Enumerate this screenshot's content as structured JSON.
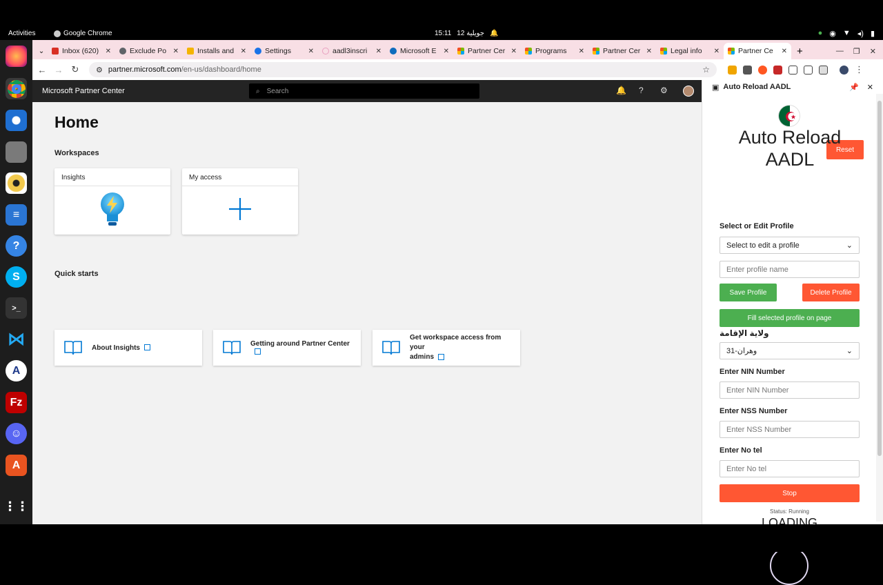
{
  "topbar": {
    "activities": "Activities",
    "app": "Google Chrome",
    "time": "15:11",
    "date": "12 جويلية"
  },
  "dock": {
    "items": [
      "firefox-icon",
      "chrome-icon",
      "thunderbird-icon",
      "files-icon",
      "rhythmbox-icon",
      "writer-icon",
      "help-icon",
      "skype-icon",
      "terminal-icon",
      "vscode-icon",
      "inkscape-icon",
      "filezilla-icon",
      "discord-icon",
      "app-center-icon",
      "apps-grid-icon"
    ]
  },
  "tabs": [
    {
      "label": "Inbox (620)",
      "color": "#d93025"
    },
    {
      "label": "Exclude Po",
      "color": "#5f6368"
    },
    {
      "label": "Installs and",
      "color": "#f4b400"
    },
    {
      "label": "Settings",
      "color": "#1a73e8"
    },
    {
      "label": "aadl3inscri",
      "color": "#e8a0bf"
    },
    {
      "label": "Microsoft E",
      "color": "#0f6cbd"
    },
    {
      "label": "Partner Cer",
      "color": "#f25022"
    },
    {
      "label": "Programs",
      "color": "#f25022"
    },
    {
      "label": "Partner Cer",
      "color": "#f25022"
    },
    {
      "label": "Legal info",
      "color": "#f25022"
    },
    {
      "label": "Partner Ce",
      "color": "#f25022"
    }
  ],
  "address": {
    "host": "partner.microsoft.com",
    "path": "/en-us/dashboard/home"
  },
  "pc": {
    "brand": "Microsoft Partner Center",
    "search_placeholder": "Search",
    "home": "Home",
    "workspaces": "Workspaces",
    "card1": "Insights",
    "card2": "My access",
    "quickstarts": "Quick starts",
    "qs1": "About Insights",
    "qs2": "Getting around Partner Center",
    "qs3a": "Get workspace access from your",
    "qs3b": "admins"
  },
  "panel": {
    "header": "Auto Reload AADL",
    "reset": "Reset",
    "title1": "Auto Reload",
    "title2": "AADL",
    "select_label": "Select or Edit Profile",
    "select_value": "Select to edit a profile",
    "profile_placeholder": "Enter profile name",
    "save": "Save Profile",
    "delete": "Delete Profile",
    "fill": "Fill selected profile on page",
    "wilaya_label": "ولاية الإقامة",
    "wilaya_value": "وهران-31",
    "nin_label": "Enter NIN Number",
    "nin_placeholder": "Enter NIN Number",
    "nss_label": "Enter NSS Number",
    "nss_placeholder": "Enter NSS Number",
    "tel_label": "Enter No tel",
    "tel_placeholder": "Enter No tel",
    "stop": "Stop",
    "status": "Status: Running",
    "loading": "LOADING"
  }
}
